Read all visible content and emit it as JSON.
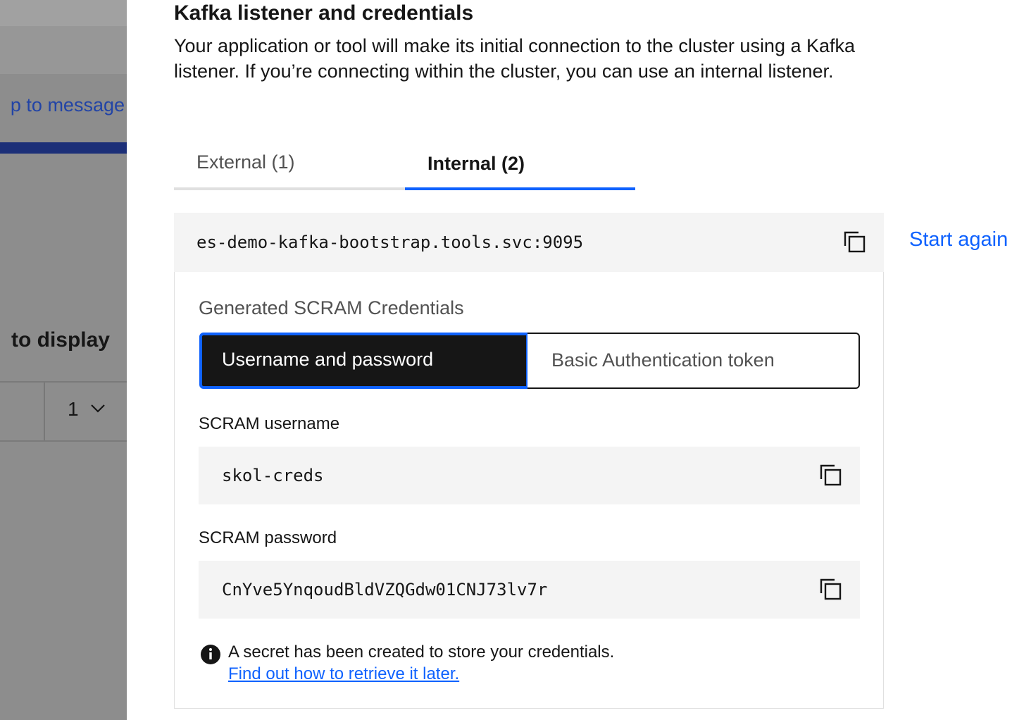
{
  "background": {
    "message_link": "p to message",
    "display_text": "to display",
    "page_number": "1"
  },
  "main": {
    "title": "Kafka listener and credentials",
    "description": "Your application or tool will make its initial connection to the cluster using a Kafka listener. If you’re connecting within the cluster, you can use an internal listener.",
    "tabs": [
      {
        "label": "External (1)",
        "selected": false
      },
      {
        "label": "Internal (2)",
        "selected": true
      }
    ],
    "listener_address": "es-demo-kafka-bootstrap.tools.svc:9095",
    "start_again": "Start again",
    "credentials": {
      "heading": "Generated SCRAM Credentials",
      "switcher": [
        {
          "label": "Username and password",
          "selected": true
        },
        {
          "label": "Basic Authentication token",
          "selected": false
        }
      ],
      "username_label": "SCRAM username",
      "username_value": "skol-creds",
      "password_label": "SCRAM password",
      "password_value": "CnYve5YnqoudBldVZQGdw01CNJ73lv7r"
    },
    "notice": {
      "text": "A secret has been created to store your credentials.",
      "link": "Find out how to retrieve it later."
    }
  },
  "colors": {
    "accent": "#0f62fe",
    "overlay": "#8d8d8d",
    "field_bg": "#f4f4f4",
    "selected_bg": "#161616"
  },
  "icons": [
    "copy-icon",
    "info-icon",
    "chevron-down-icon"
  ]
}
